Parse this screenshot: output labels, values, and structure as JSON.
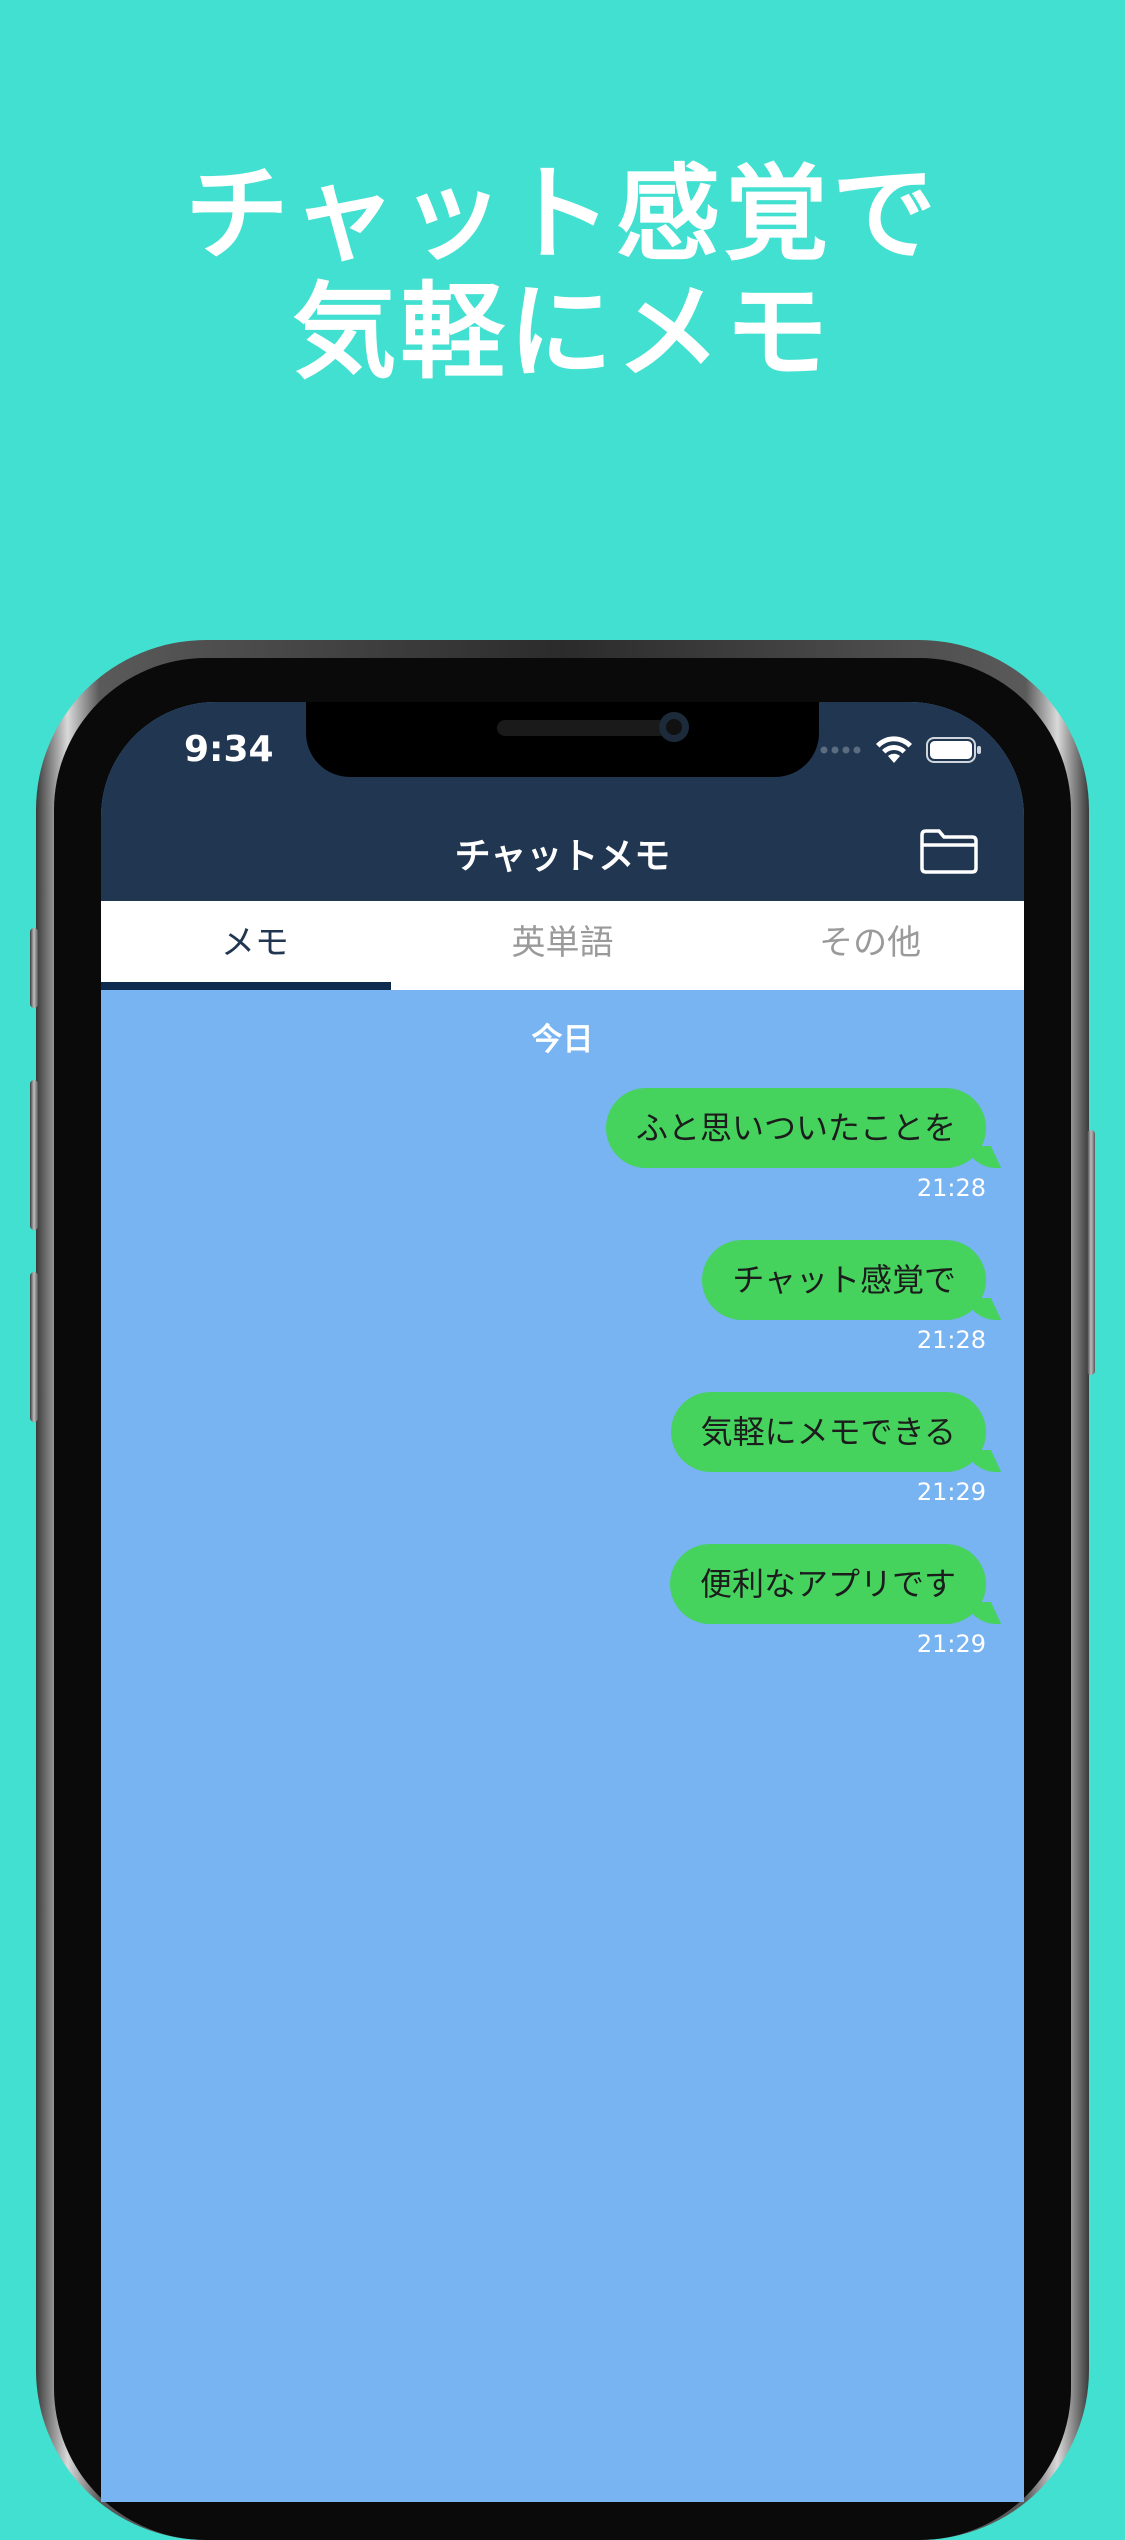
{
  "headline": {
    "line1": "チャット感覚で",
    "line2": "気軽にメモ"
  },
  "status_bar": {
    "time": "9:34"
  },
  "app": {
    "title": "チャットメモ"
  },
  "tabs": [
    {
      "label": "メモ",
      "active": true
    },
    {
      "label": "英単語",
      "active": false
    },
    {
      "label": "その他",
      "active": false
    }
  ],
  "chat": {
    "date_label": "今日",
    "messages": [
      {
        "text": "ふと思いついたことを",
        "time": "21:28"
      },
      {
        "text": "チャット感覚で",
        "time": "21:28"
      },
      {
        "text": "気軽にメモできる",
        "time": "21:29"
      },
      {
        "text": "便利なアプリです",
        "time": "21:29"
      }
    ]
  },
  "colors": {
    "background": "#41E0D0",
    "navbar": "#213651",
    "chat_background": "#78B3F2",
    "bubble": "#45D35E",
    "tab_indicator": "#0E2A4E"
  },
  "icons": {
    "folder": "folder-icon",
    "wifi": "wifi-icon",
    "battery": "battery-icon",
    "signal": "signal-icon"
  }
}
